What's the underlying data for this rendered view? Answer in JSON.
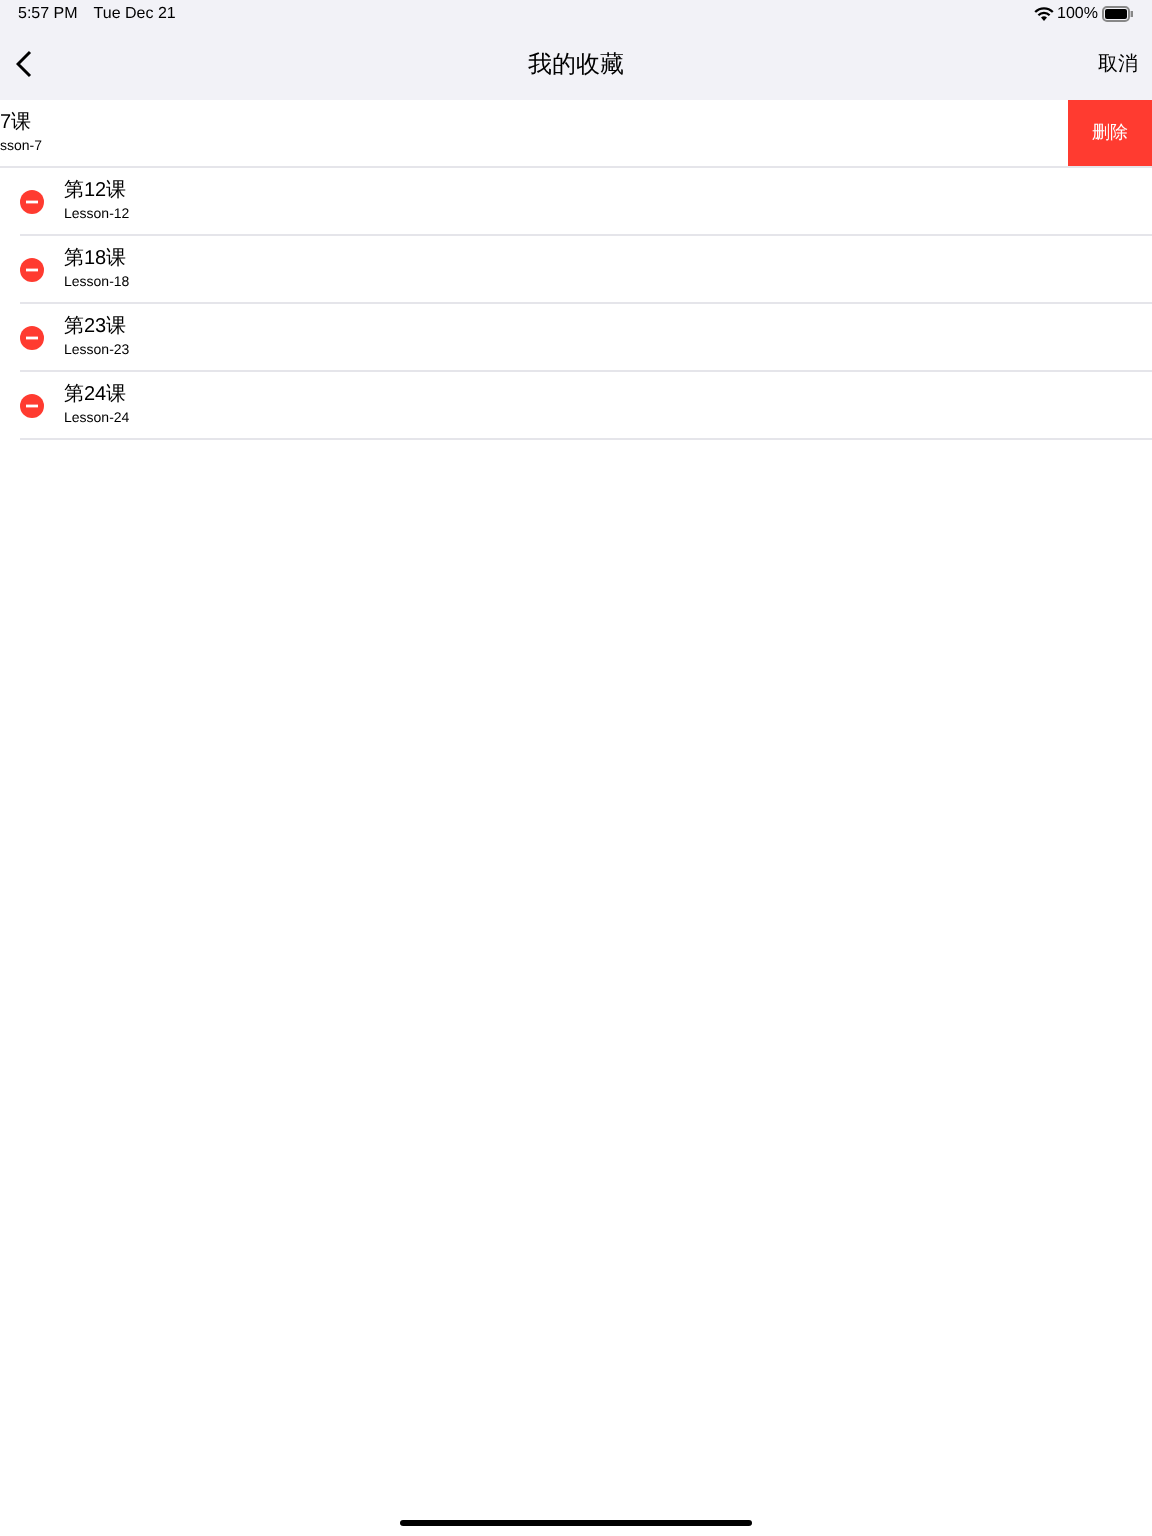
{
  "status_bar": {
    "time": "5:57 PM",
    "date": "Tue Dec 21",
    "battery": "100%"
  },
  "nav": {
    "title": "我的收藏",
    "cancel": "取消"
  },
  "items": [
    {
      "title": "7课",
      "subtitle": "sson-7",
      "swiped": true,
      "delete_label": "删除"
    },
    {
      "title": "第12课",
      "subtitle": "Lesson-12",
      "swiped": false
    },
    {
      "title": "第18课",
      "subtitle": "Lesson-18",
      "swiped": false
    },
    {
      "title": "第23课",
      "subtitle": "Lesson-23",
      "swiped": false
    },
    {
      "title": "第24课",
      "subtitle": "Lesson-24",
      "swiped": false
    }
  ]
}
